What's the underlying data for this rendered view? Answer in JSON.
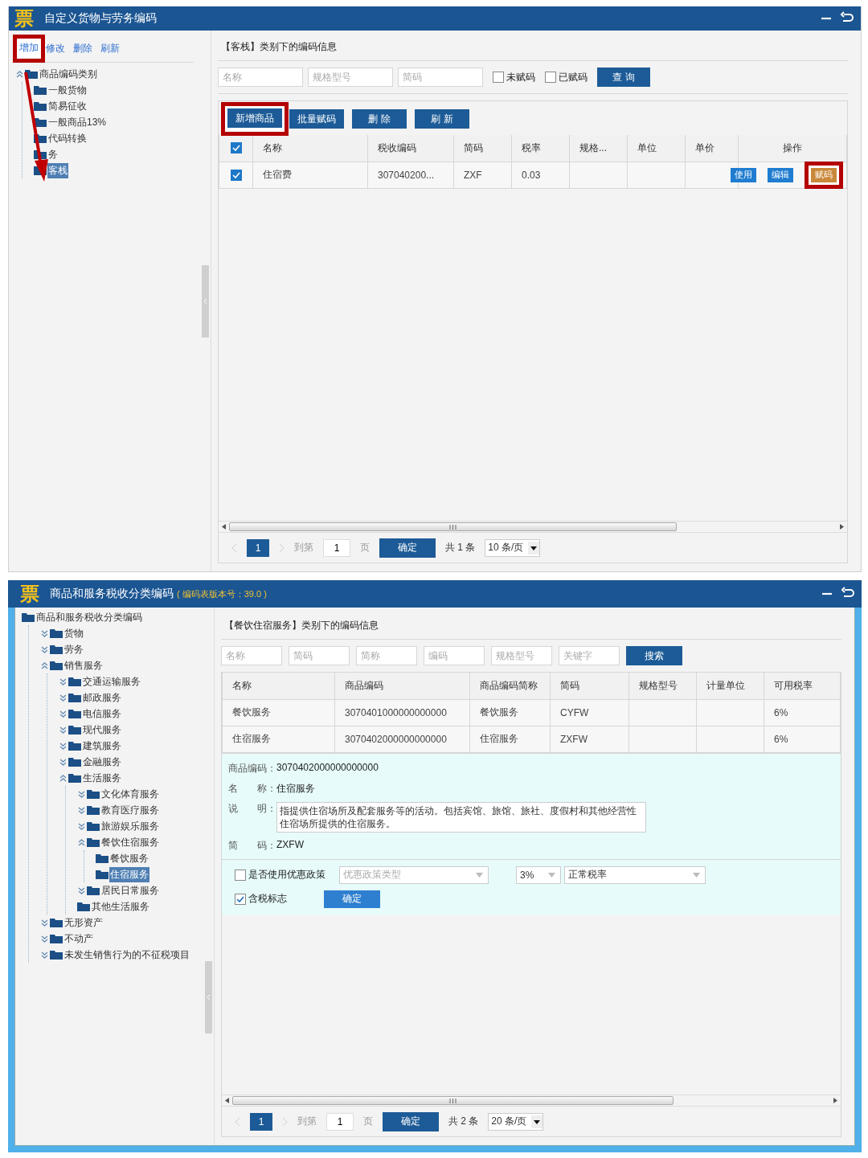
{
  "window1": {
    "logo": "票",
    "title": "自定义货物与劳务编码",
    "tree_toolbar": [
      {
        "label": "增加",
        "highlighted": true
      },
      {
        "label": "修改",
        "highlighted": false
      },
      {
        "label": "删除",
        "highlighted": false
      },
      {
        "label": "刷新",
        "highlighted": false
      }
    ],
    "tree": {
      "label": "商品编码类别",
      "expanded": true,
      "selected": false,
      "children": [
        {
          "label": "一般货物",
          "selected": false
        },
        {
          "label": "简易征收",
          "selected": false
        },
        {
          "label": "一般商品13%",
          "selected": false
        },
        {
          "label": "代码转换",
          "selected": false
        },
        {
          "label": "务",
          "selected": false
        },
        {
          "label": "客栈",
          "selected": true
        }
      ]
    },
    "panel_title": "【客栈】类别下的编码信息",
    "filters": [
      {
        "placeholder": "名称"
      },
      {
        "placeholder": "规格型号"
      },
      {
        "placeholder": "简码"
      }
    ],
    "checkboxes": [
      {
        "label": "未赋码",
        "checked": false
      },
      {
        "label": "已赋码",
        "checked": false
      }
    ],
    "query_button": "查 询",
    "actions": [
      {
        "label": "新增商品",
        "highlighted": true
      },
      {
        "label": "批量赋码",
        "highlighted": false
      },
      {
        "label": "删 除",
        "highlighted": false
      },
      {
        "label": "刷 新",
        "highlighted": false
      }
    ],
    "table": {
      "all_checked": true,
      "columns": [
        "名称",
        "税收编码",
        "简码",
        "税率",
        "规格...",
        "单位",
        "单价",
        "操作"
      ],
      "rows": [
        {
          "checked": true,
          "name": "住宿费",
          "code": "307040200...",
          "short": "ZXF",
          "rate": "0.03",
          "ops": [
            {
              "label": "使用",
              "kind": "primary",
              "highlighted": false
            },
            {
              "label": "编辑",
              "kind": "primary",
              "highlighted": false
            },
            {
              "label": "赋码",
              "kind": "warning",
              "highlighted": true
            }
          ]
        }
      ]
    },
    "pager": {
      "current": "1",
      "goto_label": "到第",
      "page_value": "1",
      "page_unit": "页",
      "confirm": "确定",
      "total": "共 1 条",
      "page_size": "10 条/页"
    }
  },
  "window2": {
    "logo": "票",
    "title": "商品和服务税收分类编码",
    "version": "( 编码表版本号：39.0 )",
    "tree": {
      "label": "商品和服务税收分类编码",
      "selected": false,
      "children": [
        {
          "label": "货物",
          "expanded": false,
          "selected": false
        },
        {
          "label": "劳务",
          "expanded": false,
          "selected": false
        },
        {
          "label": "销售服务",
          "expanded": true,
          "selected": false,
          "children": [
            {
              "label": "交通运输服务",
              "expanded": false,
              "selected": false
            },
            {
              "label": "邮政服务",
              "expanded": false,
              "selected": false
            },
            {
              "label": "电信服务",
              "expanded": false,
              "selected": false
            },
            {
              "label": "现代服务",
              "expanded": false,
              "selected": false
            },
            {
              "label": "建筑服务",
              "expanded": false,
              "selected": false
            },
            {
              "label": "金融服务",
              "expanded": false,
              "selected": false
            },
            {
              "label": "生活服务",
              "expanded": true,
              "selected": false,
              "children": [
                {
                  "label": "文化体育服务",
                  "expanded": false,
                  "selected": false
                },
                {
                  "label": "教育医疗服务",
                  "expanded": false,
                  "selected": false
                },
                {
                  "label": "旅游娱乐服务",
                  "expanded": false,
                  "selected": false
                },
                {
                  "label": "餐饮住宿服务",
                  "expanded": true,
                  "selected": false,
                  "children": [
                    {
                      "label": "餐饮服务",
                      "selected": false
                    },
                    {
                      "label": "住宿服务",
                      "selected": true
                    }
                  ]
                },
                {
                  "label": "居民日常服务",
                  "expanded": false,
                  "selected": false
                },
                {
                  "label": "其他生活服务",
                  "selected": false
                }
              ]
            }
          ]
        },
        {
          "label": "无形资产",
          "expanded": false,
          "selected": false
        },
        {
          "label": "不动产",
          "expanded": false,
          "selected": false
        },
        {
          "label": "未发生销售行为的不征税项目",
          "expanded": false,
          "selected": false
        }
      ]
    },
    "panel_title": "【餐饮住宿服务】类别下的编码信息",
    "filters": [
      {
        "placeholder": "名称"
      },
      {
        "placeholder": "简码"
      },
      {
        "placeholder": "简称"
      },
      {
        "placeholder": "编码"
      },
      {
        "placeholder": "规格型号"
      },
      {
        "placeholder": "关键字"
      }
    ],
    "search_button": "搜索",
    "table": {
      "columns": [
        "名称",
        "商品编码",
        "商品编码简称",
        "简码",
        "规格型号",
        "计量单位",
        "可用税率"
      ],
      "rows": [
        {
          "name": "餐饮服务",
          "code": "3070401000000000000",
          "abbr": "餐饮服务",
          "short": "CYFW",
          "rate": "6%"
        },
        {
          "name": "住宿服务",
          "code": "3070402000000000000",
          "abbr": "住宿服务",
          "short": "ZXFW",
          "rate": "6%"
        }
      ]
    },
    "detail": {
      "code_label": "商品编码：",
      "code": "3070402000000000000",
      "name_label": "名　　称：",
      "name": "住宿服务",
      "desc_label": "说　　明：",
      "description": "指提供住宿场所及配套服务等的活动。包括宾馆、旅馆、旅社、度假村和其他经营性住宿场所提供的住宿服务。",
      "short_label": "简　　码：",
      "short": "ZXFW",
      "policy": {
        "label": "是否使用优惠政策",
        "checked": false
      },
      "policy_type": {
        "placeholder": "优惠政策类型"
      },
      "rate": "3%",
      "rate_type": "正常税率",
      "tax_included": {
        "label": "含税标志",
        "checked": true
      },
      "confirm": "确定"
    },
    "pager": {
      "current": "1",
      "goto_label": "到第",
      "page_value": "1",
      "page_unit": "页",
      "confirm": "确定",
      "total": "共 2 条",
      "page_size": "20 条/页"
    }
  }
}
